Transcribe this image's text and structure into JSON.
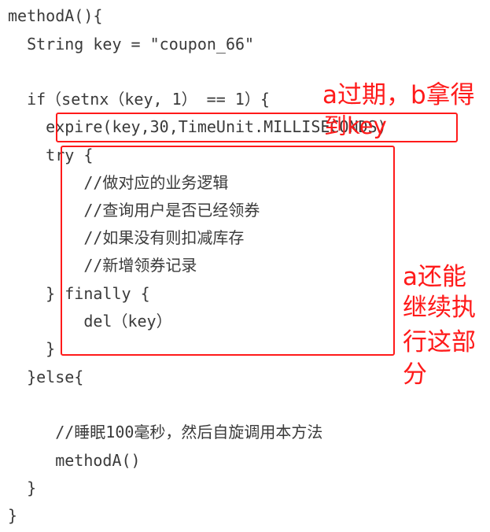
{
  "code_lines": [
    "methodA(){",
    "  String key = \"coupon_66\"",
    "",
    "  if（setnx（key, 1） == 1）{",
    "    expire(key,30,TimeUnit.MILLISECONDS)",
    "    try {",
    "        //做对应的业务逻辑",
    "        //查询用户是否已经领券",
    "        //如果没有则扣减库存",
    "        //新增领券记录",
    "    } finally {",
    "        del（key）",
    "    }",
    "  }else{",
    "",
    "     //睡眠100毫秒，然后自旋调用本方法",
    "     methodA()",
    "  }",
    "}"
  ],
  "annotations": {
    "expire_note_line1": "a过期，b拿得",
    "expire_note_line2": "到key",
    "try_note_line1": "a还能",
    "try_note_line2": "继续执",
    "try_note_line3": "行这部",
    "try_note_line4": "分"
  },
  "colors": {
    "code_text": "#3a3a3a",
    "annotation": "#ff1a1a",
    "background": "#ffffff"
  }
}
